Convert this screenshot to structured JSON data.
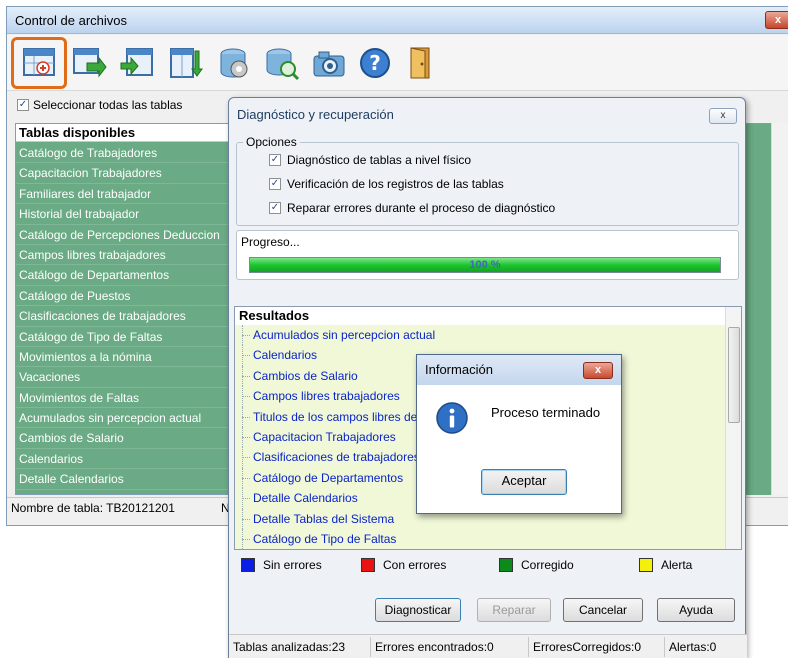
{
  "main": {
    "title": "Control de archivos",
    "close_glyph": "x",
    "select_all_label": "Seleccionar todas las tablas",
    "select_all_checked": true,
    "tables_header": "Tablas disponibles",
    "tables": [
      "Catálogo de Trabajadores",
      "Capacitacion Trabajadores",
      "Familiares del trabajador",
      "Historial del trabajador",
      "Catálogo de Percepciones Deduccion",
      "Campos libres trabajadores",
      "Catálogo de Departamentos",
      "Catálogo de Puestos",
      "Clasificaciones de trabajadores",
      "Catálogo de Tipo de Faltas",
      "Movimientos a la nómina",
      "Vacaciones",
      "Movimientos de Faltas",
      "Acumulados sin percepcion actual",
      "Cambios de Salario",
      "Calendarios",
      "Detalle Calendarios"
    ],
    "status_table_name": "Nombre de tabla: TB20121201",
    "status_next": "N"
  },
  "toolbar": {
    "icons": [
      "add-table-icon",
      "export-table-icon",
      "import-table-icon",
      "sort-table-icon",
      "database-repair-icon",
      "database-search-icon",
      "camera-icon",
      "help-icon",
      "exit-door-icon"
    ]
  },
  "dialog": {
    "title": "Diagnóstico y recuperación",
    "close_glyph": "x",
    "options_legend": "Opciones",
    "options": [
      {
        "label": "Diagnóstico de  tablas a nivel físico",
        "checked": true
      },
      {
        "label": "Verificación de los registros de las tablas",
        "checked": true
      },
      {
        "label": "Reparar errores durante el proceso de diagnóstico",
        "checked": true
      }
    ],
    "progress_label": "Progreso...",
    "progress_text": "100 %",
    "progress_value": 1.0,
    "results_header": "Resultados",
    "results": [
      "Acumulados sin percepcion actual",
      "Calendarios",
      "Cambios de Salario",
      "Campos libres trabajadores",
      "Titulos de los campos libres de",
      "Capacitacion Trabajadores",
      "Clasificaciones de trabajadores",
      "Catálogo de Departamentos",
      "Detalle Calendarios",
      "Detalle Tablas del Sistema",
      "Catálogo de Tipo de Faltas"
    ],
    "legend": [
      {
        "label": "Sin errores",
        "color": "#0a1ee8"
      },
      {
        "label": "Con errores",
        "color": "#e81414"
      },
      {
        "label": "Corregido",
        "color": "#0c8a1c"
      },
      {
        "label": "Alerta",
        "color": "#f4f00a"
      }
    ],
    "buttons": {
      "diagnose": "Diagnosticar",
      "repair": "Reparar",
      "cancel": "Cancelar",
      "help": "Ayuda"
    },
    "status": {
      "analyzed": "Tablas analizadas:23",
      "errors_found": "Errores encontrados:0",
      "errors_fixed": "ErroresCorregidos:0",
      "alerts": "Alertas:0"
    }
  },
  "message_box": {
    "title": "Información",
    "close_glyph": "x",
    "message": "Proceso terminado",
    "ok_label": "Aceptar",
    "icon": "info-icon"
  },
  "colors": {
    "table_highlight": "#6aaa84",
    "result_row_bg": "#f0f8d8",
    "result_text": "#0a24c8",
    "toolbar_highlight": "#e06c1a",
    "progress_fill": "#1dc52f"
  }
}
